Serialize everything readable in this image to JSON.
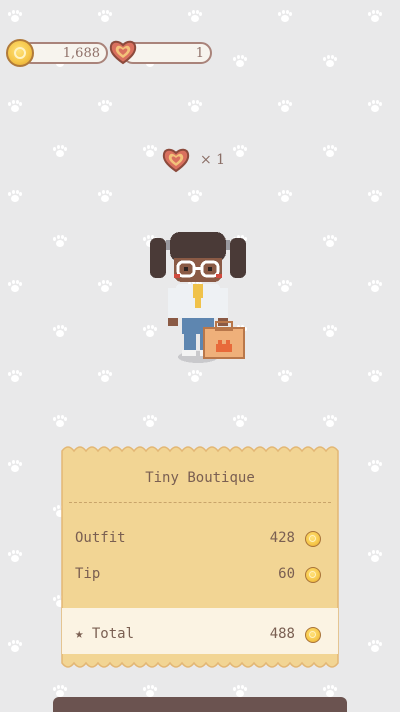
{
  "hud": {
    "coins": "1,688",
    "hearts": "1"
  },
  "reward": {
    "icon": "heart-icon",
    "multiplier": "× 1"
  },
  "receipt": {
    "title": "Tiny Boutique",
    "items": [
      {
        "label": "Outfit",
        "amount": "428"
      },
      {
        "label": "Tip",
        "amount": "60"
      }
    ],
    "total": {
      "label": "★ Total",
      "amount": "488"
    }
  },
  "colors": {
    "background": "#e9e9ea",
    "receipt_paper": "#f2d594",
    "receipt_total_band": "#fbf3e3",
    "receipt_border": "#e3b775",
    "text": "#7a5f52",
    "coin": "#f6c74a",
    "heart": "#d9705e",
    "bottom_bar": "#6b5350"
  }
}
